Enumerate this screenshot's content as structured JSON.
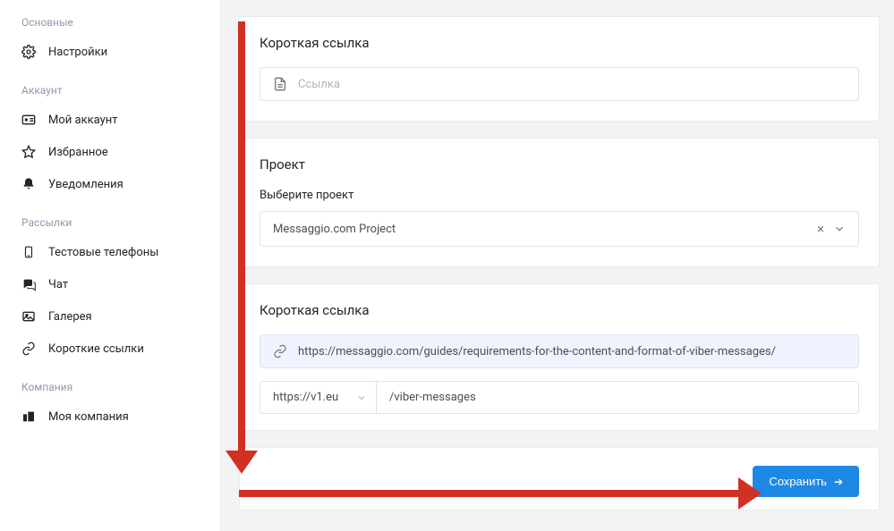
{
  "sidebar": {
    "groups": [
      {
        "label": "Основные",
        "items": [
          {
            "label": "Настройки",
            "icon": "gear-icon"
          }
        ]
      },
      {
        "label": "Аккаунт",
        "items": [
          {
            "label": "Мой аккаунт",
            "icon": "badge-icon"
          },
          {
            "label": "Избранное",
            "icon": "star-icon"
          },
          {
            "label": "Уведомления",
            "icon": "bell-icon"
          }
        ]
      },
      {
        "label": "Рассылки",
        "items": [
          {
            "label": "Тестовые телефоны",
            "icon": "phone-icon"
          },
          {
            "label": "Чат",
            "icon": "chat-icon"
          },
          {
            "label": "Галерея",
            "icon": "gallery-icon"
          },
          {
            "label": "Короткие ссылки",
            "icon": "link-icon"
          }
        ]
      },
      {
        "label": "Компания",
        "items": [
          {
            "label": "Моя компания",
            "icon": "company-icon"
          }
        ]
      }
    ]
  },
  "cards": {
    "shortlink1": {
      "title": "Короткая ссылка",
      "input_placeholder": "Ссылка"
    },
    "project": {
      "title": "Проект",
      "field_label": "Выберите проект",
      "selected": "Messaggio.com Project"
    },
    "shortlink2": {
      "title": "Короткая ссылка",
      "full_url": "https://messaggio.com/guides/requirements-for-the-content-and-format-of-viber-messages/",
      "domain": "https://v1.eu",
      "slug": "/viber-messages"
    }
  },
  "save_button": "Сохранить",
  "annotation_color": "#d13024"
}
